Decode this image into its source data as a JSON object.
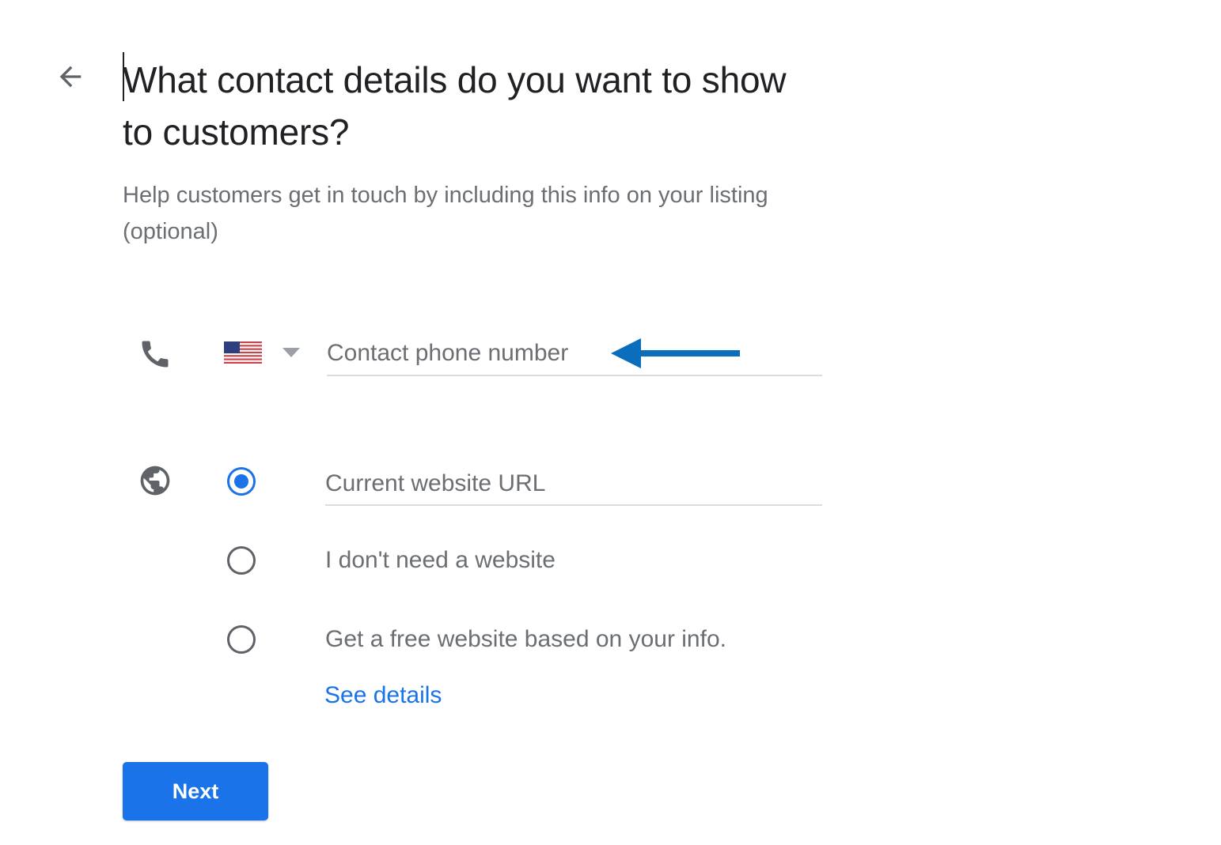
{
  "header": {
    "back_icon": "arrow-back-icon",
    "title": "What contact details do you want to show to customers?",
    "subtitle": "Help customers get in touch by including this info on your listing (optional)"
  },
  "phone": {
    "icon": "phone-icon",
    "country_flag": "US",
    "country_dropdown_icon": "triangle-down-icon",
    "placeholder": "Contact phone number",
    "value": "",
    "annotation_arrow_color": "#0a6ebd"
  },
  "website": {
    "icon": "globe-icon",
    "options": [
      {
        "type": "input",
        "placeholder": "Current website URL",
        "value": "",
        "selected": true
      },
      {
        "type": "label",
        "label": "I don't need a website",
        "selected": false
      },
      {
        "type": "label",
        "label": "Get a free website based on your info.",
        "selected": false
      }
    ],
    "see_details_link": "See details"
  },
  "actions": {
    "next_label": "Next"
  },
  "colors": {
    "accent": "#1a73e8",
    "text_primary": "#202124",
    "text_secondary": "#6b6e72",
    "divider": "#dadce0"
  }
}
